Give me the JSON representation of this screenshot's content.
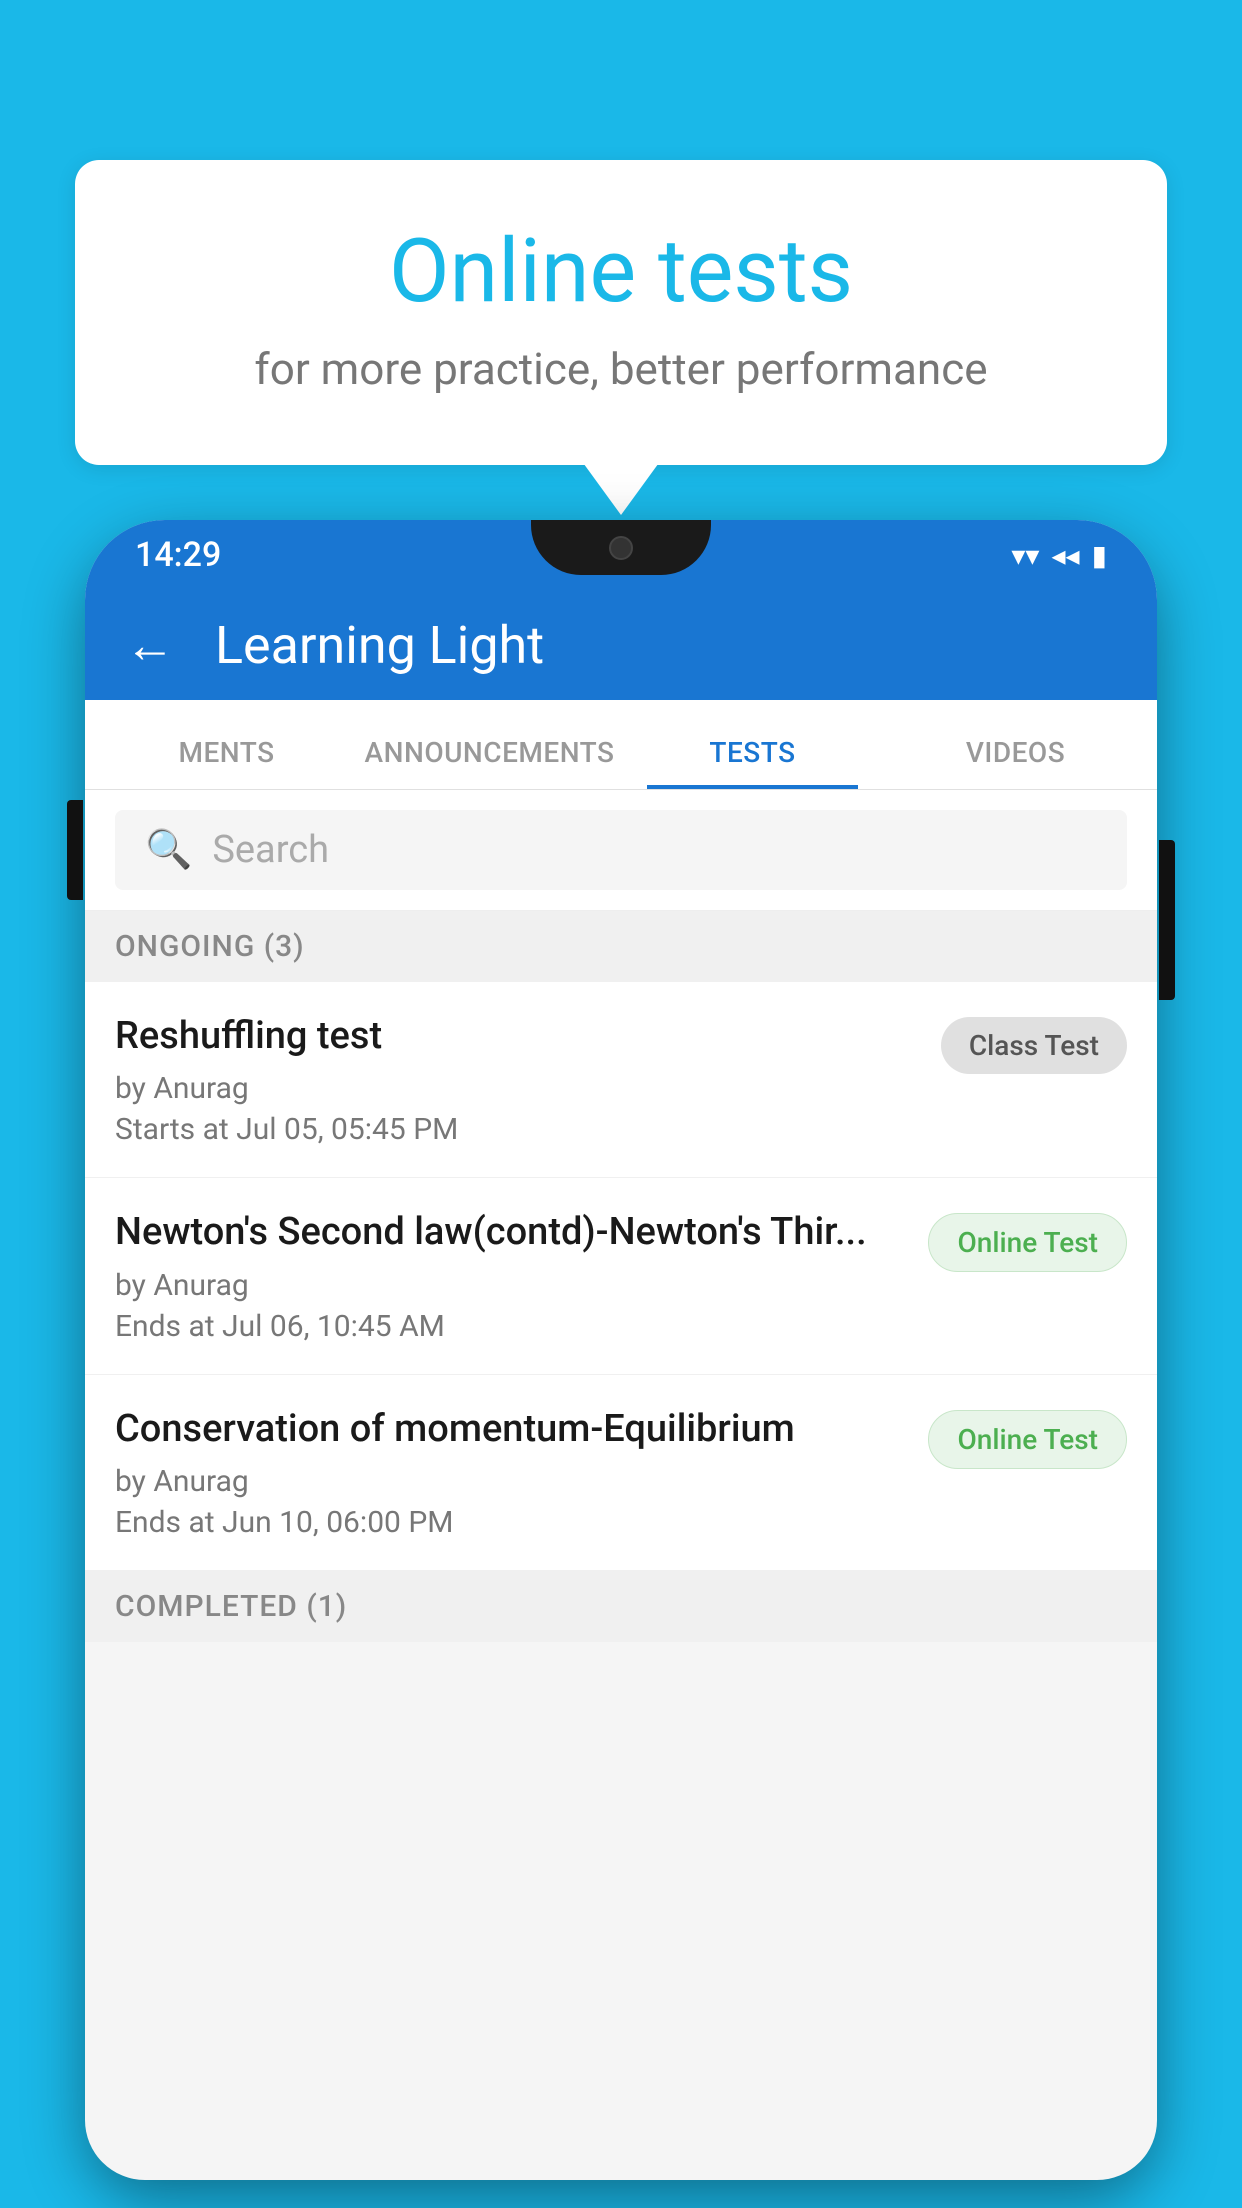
{
  "background": {
    "color": "#1AB8E8"
  },
  "speech_bubble": {
    "title": "Online tests",
    "subtitle": "for more practice, better performance"
  },
  "status_bar": {
    "time": "14:29",
    "wifi": "▼",
    "signal": "◀",
    "battery": "▮"
  },
  "app_bar": {
    "back_label": "←",
    "title": "Learning Light"
  },
  "tabs": [
    {
      "label": "MENTS",
      "active": false
    },
    {
      "label": "ANNOUNCEMENTS",
      "active": false
    },
    {
      "label": "TESTS",
      "active": true
    },
    {
      "label": "VIDEOS",
      "active": false
    }
  ],
  "search": {
    "placeholder": "Search"
  },
  "sections": {
    "ongoing": {
      "label": "ONGOING (3)",
      "tests": [
        {
          "name": "Reshuffling test",
          "by": "by Anurag",
          "date": "Starts at  Jul 05, 05:45 PM",
          "badge": "Class Test",
          "badge_type": "class"
        },
        {
          "name": "Newton's Second law(contd)-Newton's Thir...",
          "by": "by Anurag",
          "date": "Ends at  Jul 06, 10:45 AM",
          "badge": "Online Test",
          "badge_type": "online"
        },
        {
          "name": "Conservation of momentum-Equilibrium",
          "by": "by Anurag",
          "date": "Ends at  Jun 10, 06:00 PM",
          "badge": "Online Test",
          "badge_type": "online"
        }
      ]
    },
    "completed": {
      "label": "COMPLETED (1)"
    }
  }
}
